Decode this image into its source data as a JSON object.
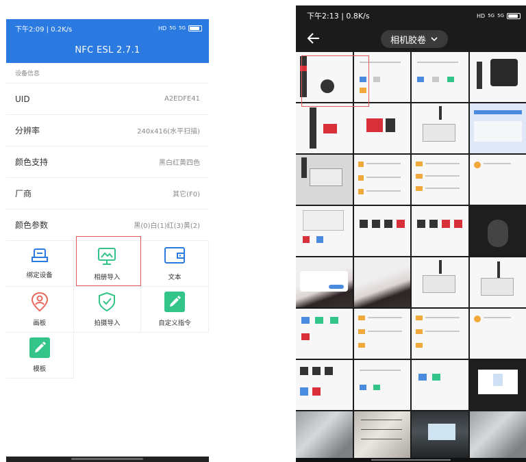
{
  "left": {
    "status": {
      "time_speed": "下午2:09 | 0.2K/s",
      "hd": "HD",
      "signal_a": "5G",
      "signal_b": "5G"
    },
    "app_title": "NFC ESL  2.7.1",
    "section_title": "设备信息",
    "info_rows": [
      {
        "label": "UID",
        "value": "A2EDFE41"
      },
      {
        "label": "分辨率",
        "value": "240x416(水平扫描)"
      },
      {
        "label": "颜色支持",
        "value": "黑白红黄四色"
      },
      {
        "label": "厂商",
        "value": "其它(F0)"
      },
      {
        "label": "颜色参数",
        "value": "黑(0)白(1)红(3)黄(2)"
      }
    ],
    "grid_items": [
      {
        "label": "绑定设备",
        "icon": "bind-device-icon"
      },
      {
        "label": "相册导入",
        "icon": "gallery-import-icon",
        "highlighted": true
      },
      {
        "label": "文本",
        "icon": "text-icon"
      },
      {
        "label": "画板",
        "icon": "drawing-board-icon"
      },
      {
        "label": "拍摄导入",
        "icon": "camera-import-icon"
      },
      {
        "label": "自定义指令",
        "icon": "custom-command-icon"
      },
      {
        "label": "模板",
        "icon": "template-icon"
      }
    ],
    "colors": {
      "primary": "#2a7ae2",
      "accent": "#33c48a",
      "highlight": "#e05a5a"
    }
  },
  "right": {
    "status": {
      "time_speed": "下午2:13 | 0.8K/s",
      "hd": "HD",
      "signal_a": "5G",
      "signal_b": "5G"
    },
    "album_title": "相机胶卷"
  }
}
